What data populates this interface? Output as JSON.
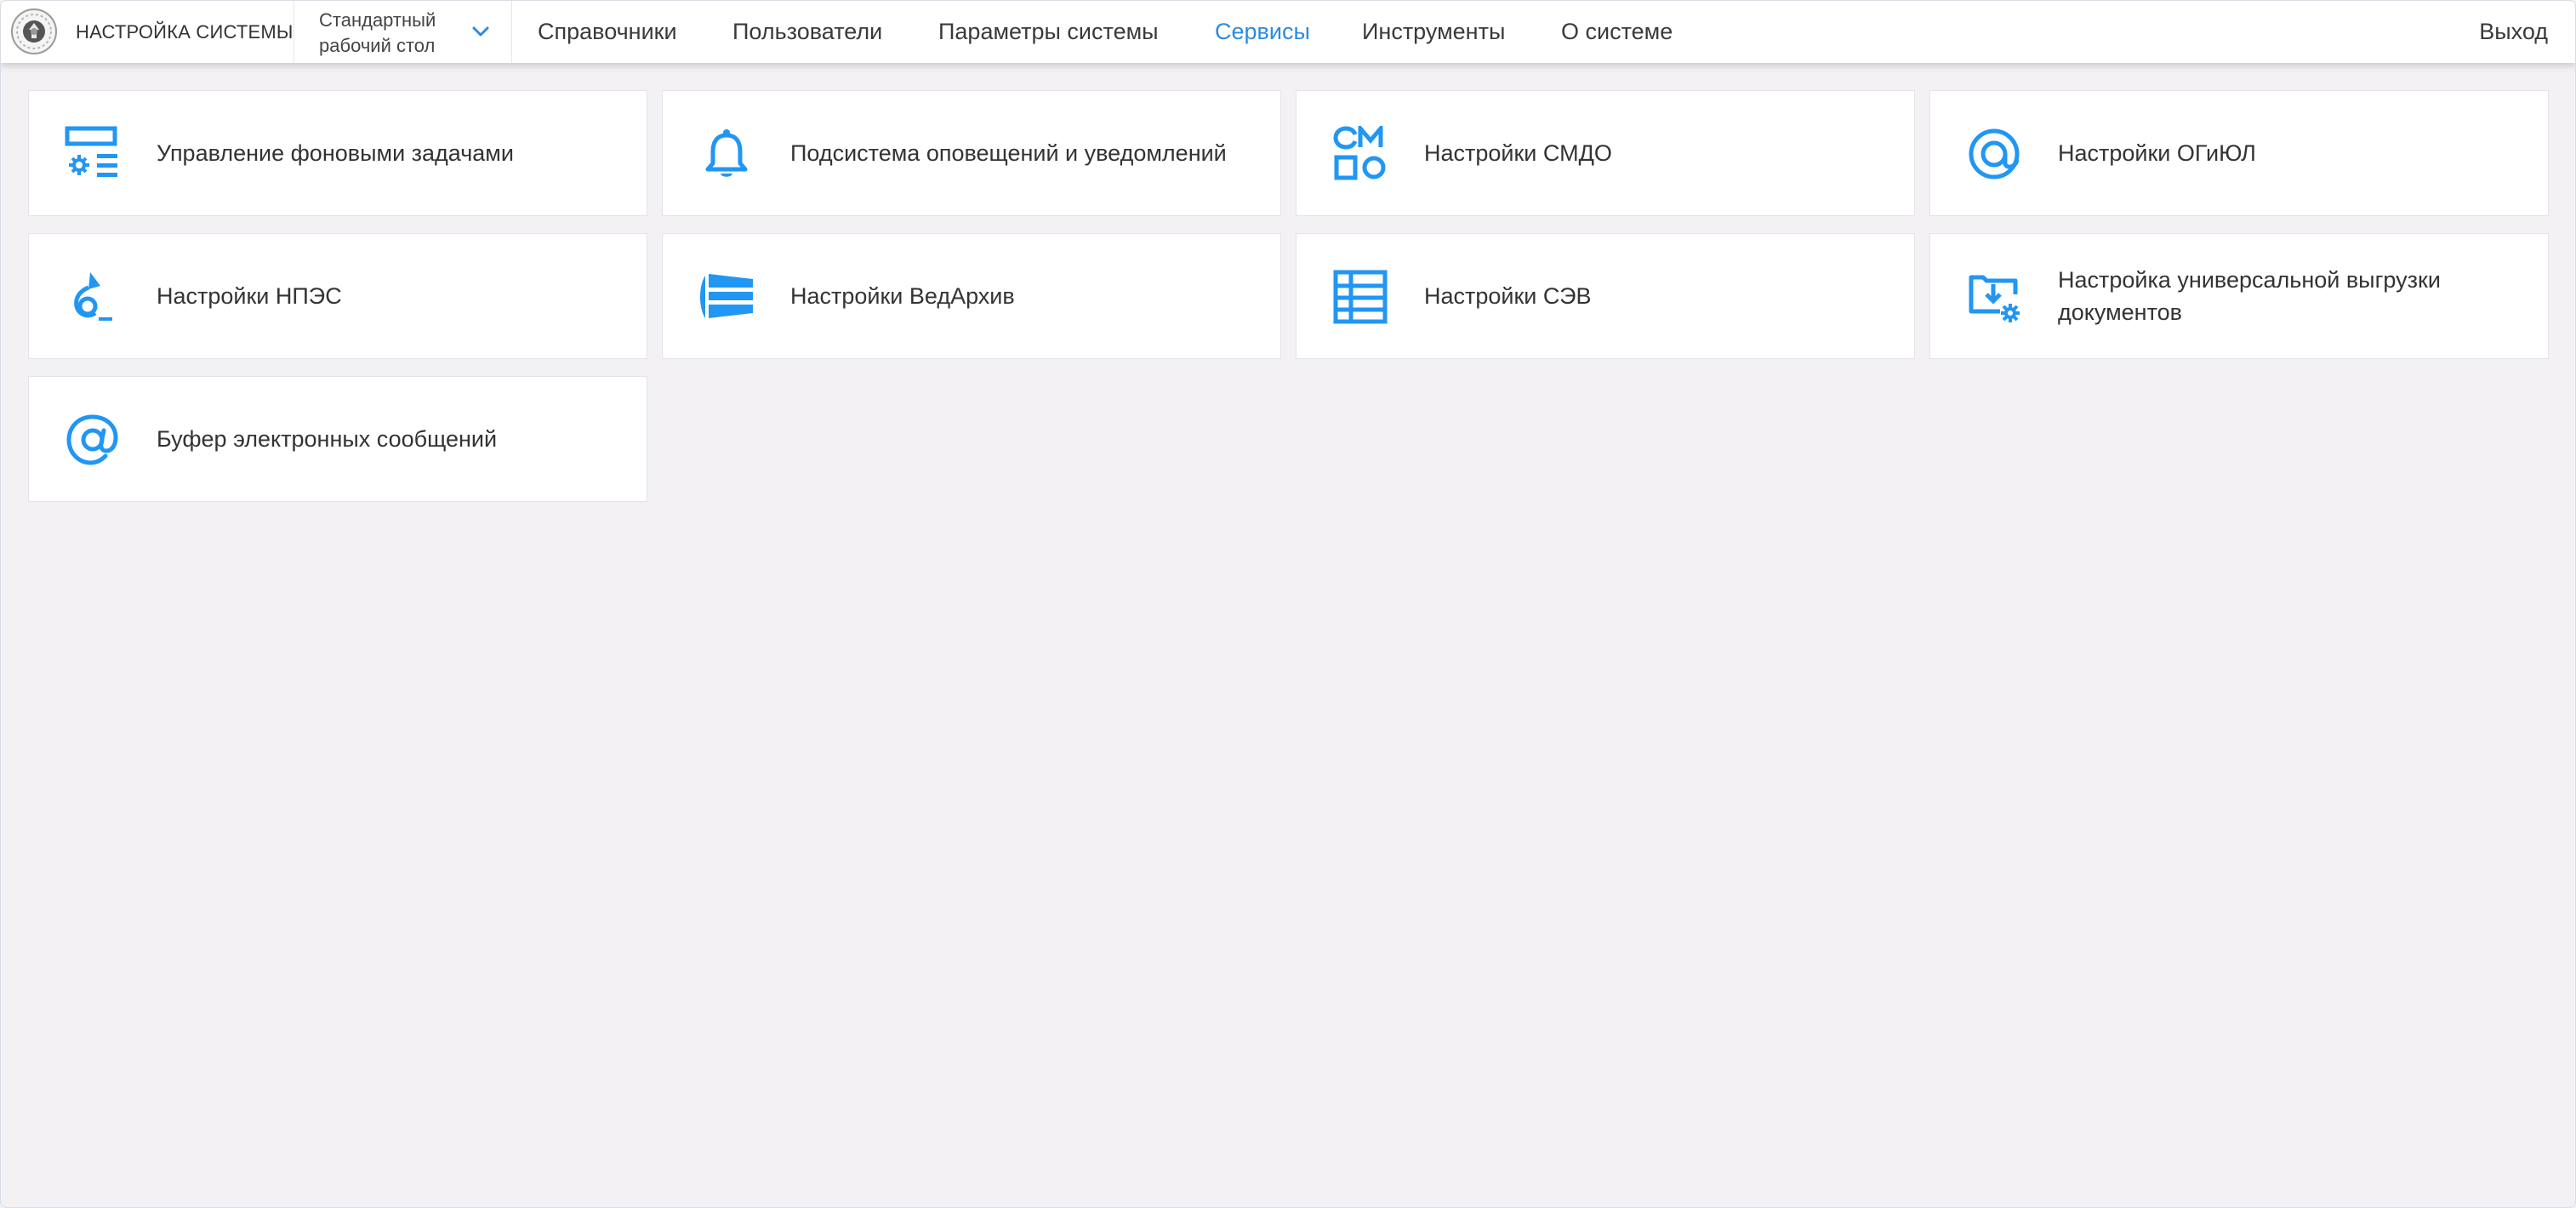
{
  "header": {
    "brand": "НАСТРОЙКА СИСТЕМЫ",
    "workspace_selector": "Стандартный рабочий стол",
    "nav": [
      {
        "label": "Справочники",
        "active": false
      },
      {
        "label": "Пользователи",
        "active": false
      },
      {
        "label": "Параметры системы",
        "active": false
      },
      {
        "label": "Сервисы",
        "active": true
      },
      {
        "label": "Инструменты",
        "active": false
      },
      {
        "label": "О системе",
        "active": false
      }
    ],
    "logout": "Выход"
  },
  "tiles": [
    {
      "label": "Управление фоновыми задачами",
      "icon": "background-tasks-icon"
    },
    {
      "label": "Подсистема оповещений и уведомлений",
      "icon": "bell-icon"
    },
    {
      "label": "Настройки СМДО",
      "icon": "smdo-icon"
    },
    {
      "label": "Настройки ОГиЮЛ",
      "icon": "at-circle-icon"
    },
    {
      "label": "Настройки НПЭС",
      "icon": "npes-icon"
    },
    {
      "label": "Настройки ВедАрхив",
      "icon": "archive-icon"
    },
    {
      "label": "Настройки СЭВ",
      "icon": "table-icon"
    },
    {
      "label": "Настройка универсальной выгрузки документов",
      "icon": "folder-export-icon"
    },
    {
      "label": "Буфер электронных сообщений",
      "icon": "at-icon"
    }
  ],
  "colors": {
    "accent": "#2a8be0",
    "icon": "#2196f3",
    "background": "#f3f1f3",
    "tile": "#ffffff",
    "text": "#333333"
  }
}
